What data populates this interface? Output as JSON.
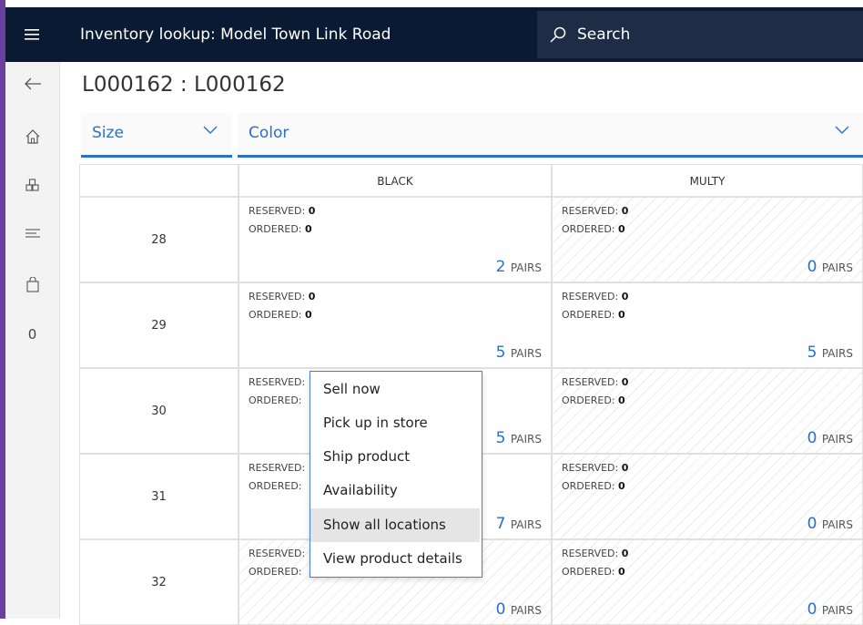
{
  "app": {
    "title": "Inventory lookup: Model Town Link Road"
  },
  "search": {
    "placeholder": "Search"
  },
  "nav": {
    "cart_count": "0"
  },
  "page": {
    "title": "L000162 : L000162"
  },
  "headers": {
    "size_label": "Size",
    "color_label": "Color"
  },
  "grid": {
    "columns": [
      "BLACK",
      "MULTY"
    ],
    "reserved_label": "RESERVED:",
    "ordered_label": "ORDERED:",
    "pairs_unit": "PAIRS",
    "rows": [
      {
        "size": "28",
        "cells": [
          {
            "reserved": "0",
            "ordered": "0",
            "pairs": "2"
          },
          {
            "reserved": "0",
            "ordered": "0",
            "pairs": "0"
          }
        ]
      },
      {
        "size": "29",
        "cells": [
          {
            "reserved": "0",
            "ordered": "0",
            "pairs": "5"
          },
          {
            "reserved": "0",
            "ordered": "0",
            "pairs": "5"
          }
        ]
      },
      {
        "size": "30",
        "cells": [
          {
            "reserved": "",
            "ordered": "",
            "pairs": "5"
          },
          {
            "reserved": "0",
            "ordered": "0",
            "pairs": "0"
          }
        ]
      },
      {
        "size": "31",
        "cells": [
          {
            "reserved": "",
            "ordered": "",
            "pairs": "7"
          },
          {
            "reserved": "0",
            "ordered": "0",
            "pairs": "0"
          }
        ]
      },
      {
        "size": "32",
        "cells": [
          {
            "reserved": "",
            "ordered": "",
            "pairs": "0"
          },
          {
            "reserved": "0",
            "ordered": "0",
            "pairs": "0"
          }
        ]
      }
    ]
  },
  "context_menu": {
    "items": [
      "Sell now",
      "Pick up in store",
      "Ship product",
      "Availability",
      "Show all locations",
      "View product details"
    ],
    "highlighted": "Show all locations"
  }
}
